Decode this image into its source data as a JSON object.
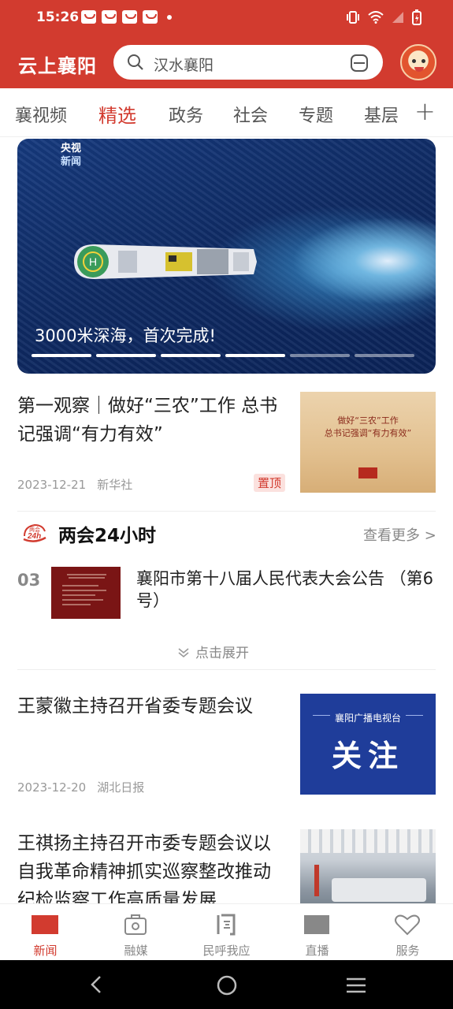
{
  "status": {
    "time": "15:26"
  },
  "appbar": {
    "logo": "云上襄阳",
    "search_placeholder": "汉水襄阳"
  },
  "tabs": [
    "襄视频",
    "精选",
    "政务",
    "社会",
    "专题",
    "基层"
  ],
  "active_tab": "精选",
  "banner": {
    "badge_line1": "央视",
    "badge_line2": "新闻",
    "caption": "3000米深海，首次完成!",
    "indicator_count": 6,
    "active_indicator": 3
  },
  "news": [
    {
      "title": "第一观察｜做好“三农”工作 总书记强调“有力有效”",
      "date": "2023-12-21",
      "source": "新华社",
      "badge": "置顶",
      "thumb_line1": "做好“三农”工作",
      "thumb_line2": "总书记强调“有力有效”"
    },
    {
      "title": "王蒙徽主持召开省委专题会议",
      "date": "2023-12-20",
      "source": "湖北日报",
      "thumb_line1": "襄阳广播电视台",
      "thumb_line2": "关注"
    },
    {
      "title": "王祺扬主持召开市委专题会议以自我革命精神抓实巡察整改推动纪检监察工作高质量发展"
    }
  ],
  "lianghui": {
    "icon_text": "两会 24h",
    "title": "两会24小时",
    "more": "查看更多 >",
    "item_num": "03",
    "item_title": "襄阳市第十八届人民代表大会公告 （第6号）",
    "expand": "点击展开"
  },
  "bottom_nav": [
    {
      "label": "新闻",
      "icon": "news-icon"
    },
    {
      "label": "融媒",
      "icon": "media-box-icon"
    },
    {
      "label": "民呼我应",
      "icon": "question-icon"
    },
    {
      "label": "直播",
      "icon": "live-icon"
    },
    {
      "label": "服务",
      "icon": "heart-icon"
    }
  ],
  "active_nav": "新闻",
  "colors": {
    "brand": "#d23b2f",
    "muted": "#888888"
  }
}
